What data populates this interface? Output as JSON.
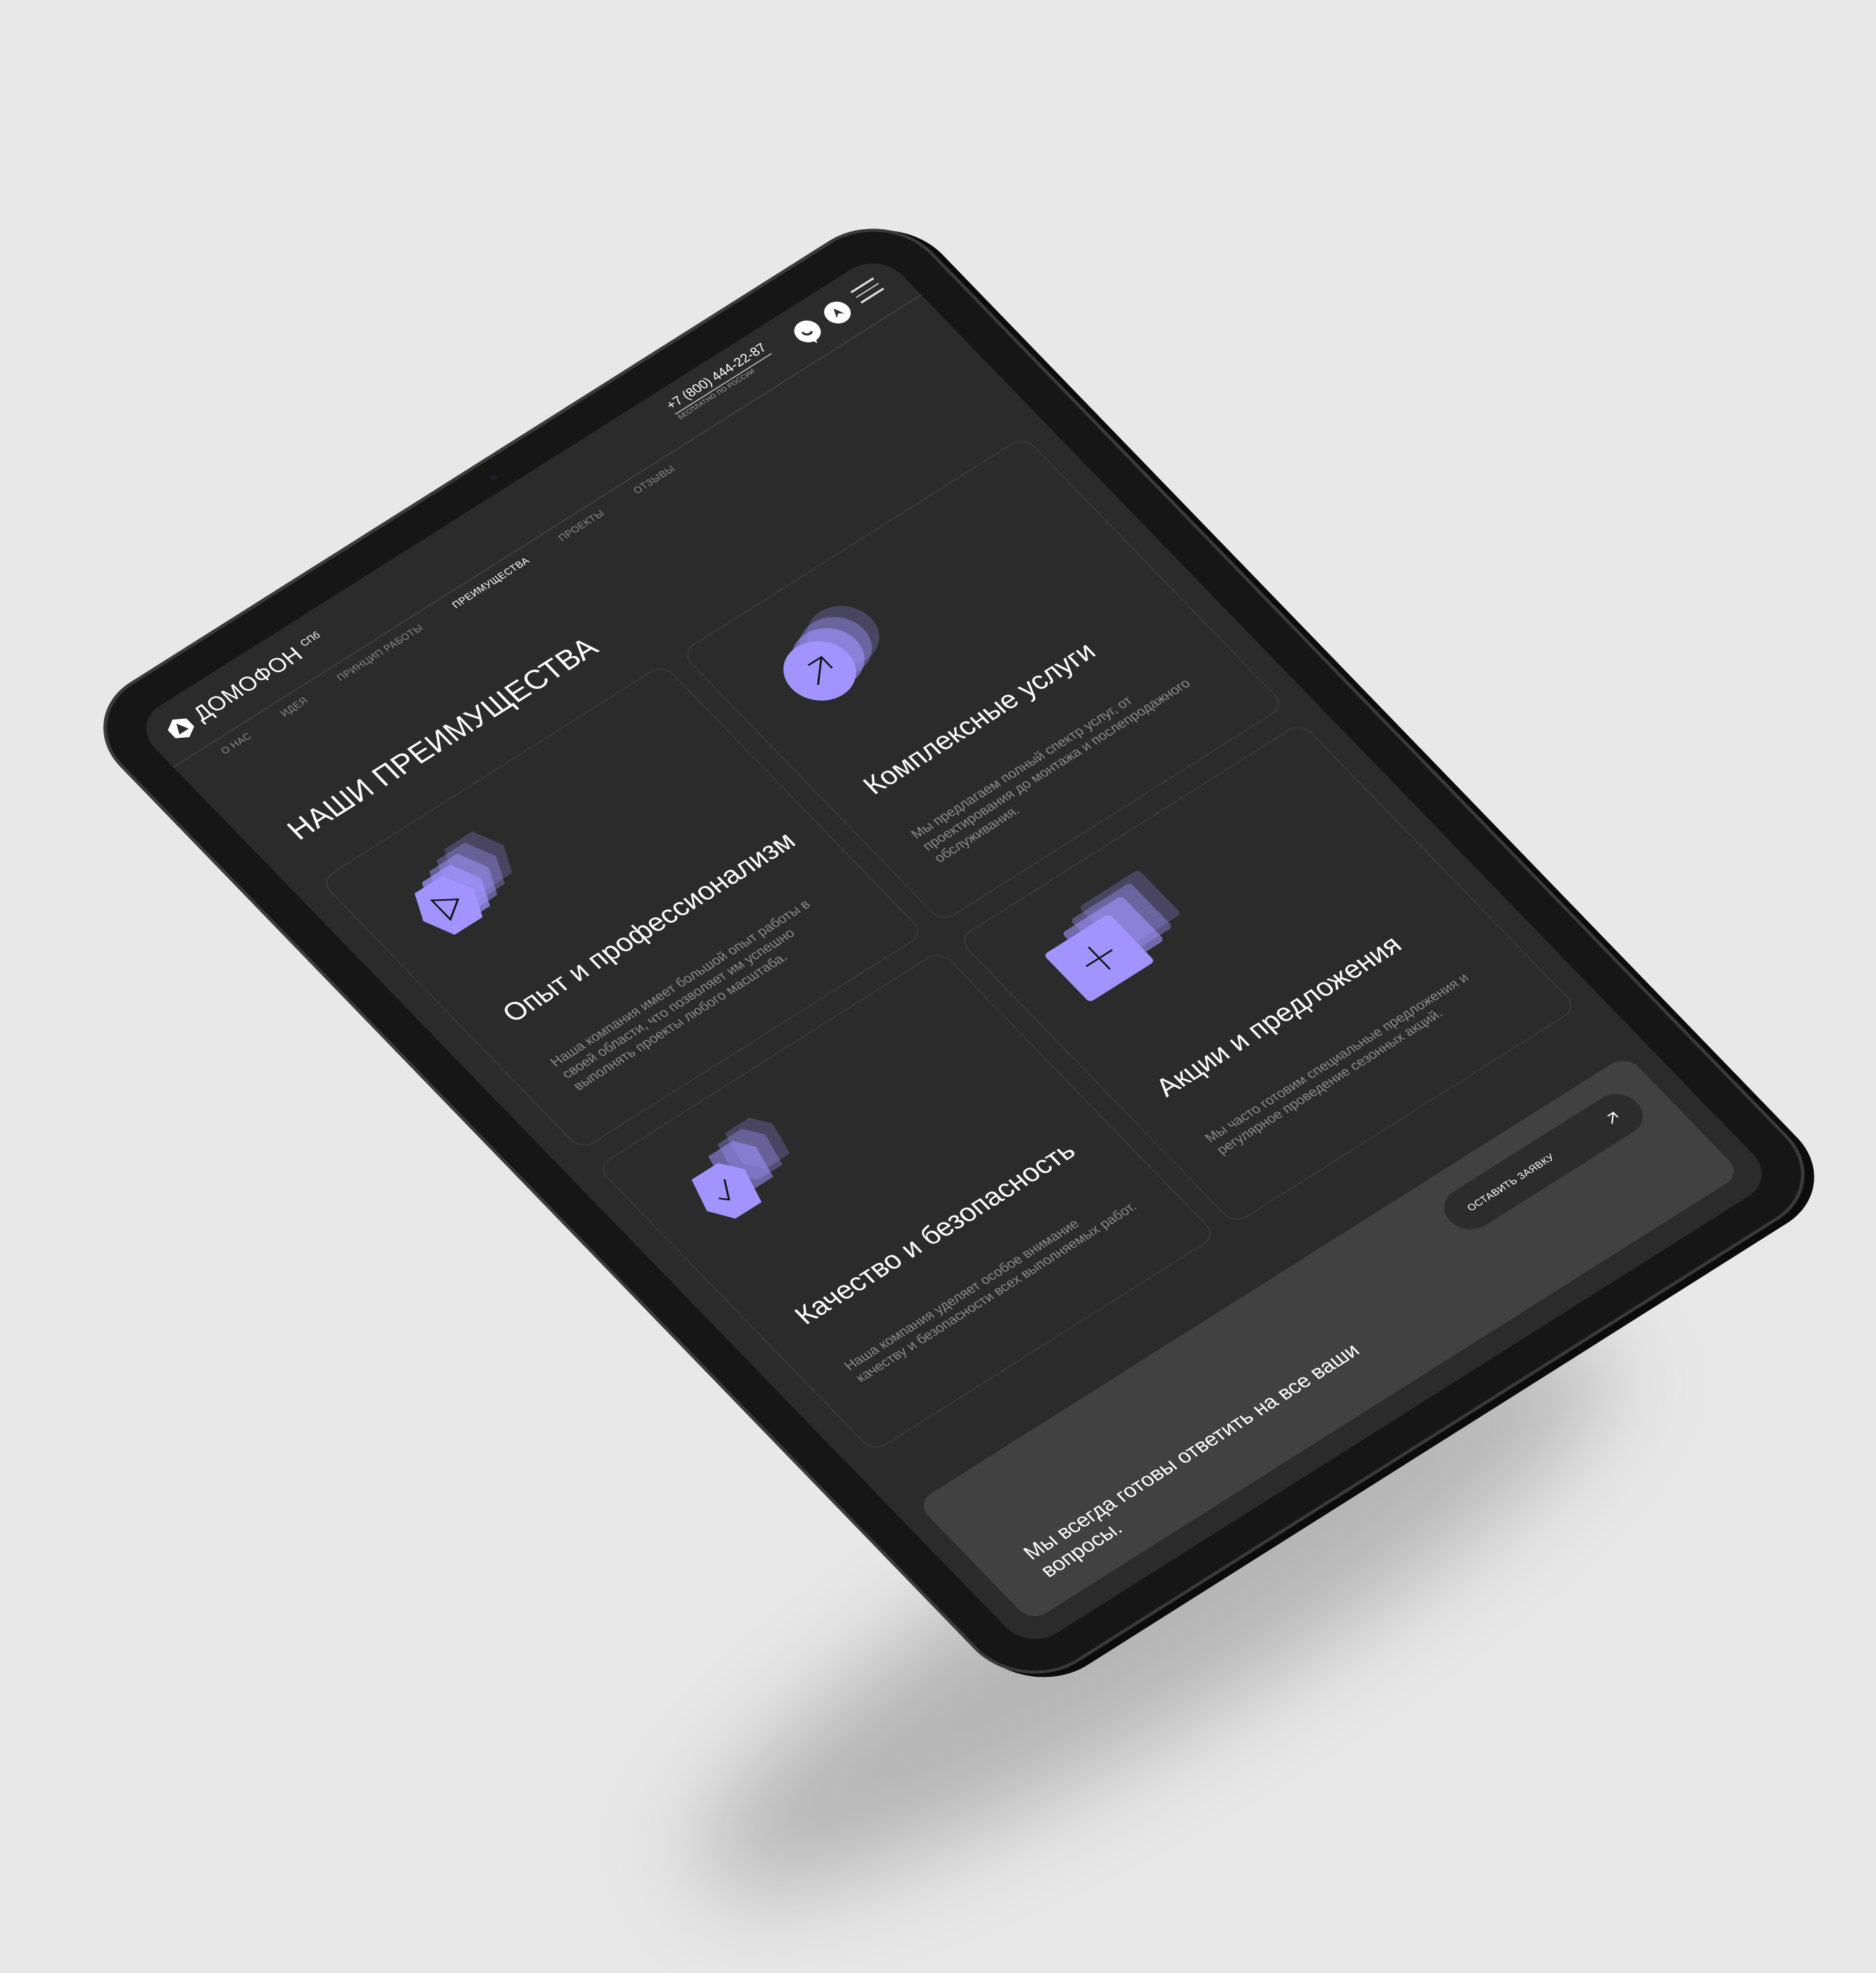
{
  "colors": {
    "accent": "#a393ff",
    "screen_bg": "#2b2b2b",
    "band_bg": "#414141",
    "page_bg": "#e8e8e8"
  },
  "header": {
    "logo": {
      "word": "ДОМОФОН",
      "sup": "СПб",
      "icon": "logo-hexagon-icon"
    },
    "phone": {
      "number": "+7 (800) 444-22-87",
      "note": "БЕСПЛАТНО ПО РОССИИ"
    },
    "icons": [
      "chat-phone-icon",
      "telegram-icon",
      "hamburger-menu-icon"
    ]
  },
  "nav": {
    "items": [
      {
        "label": "О НАС",
        "active": false
      },
      {
        "label": "ИДЕЯ",
        "active": false
      },
      {
        "label": "ПРИНЦИП РАБОТЫ",
        "active": false
      },
      {
        "label": "ПРЕИМУЩЕСТВА",
        "active": true
      },
      {
        "label": "ПРОЕКТЫ",
        "active": false
      },
      {
        "label": "ОТЗЫВЫ",
        "active": false
      }
    ]
  },
  "main": {
    "title": "НАШИ ПРЕИМУЩЕСТВА",
    "cards": [
      {
        "title": "Опыт и профессионализм",
        "text": "Наша компания имеет большой опыт работы в своей области, что позволяет им успешно выполнять проекты любого масштаба.",
        "icon": "play-icon"
      },
      {
        "title": "Комплексные услуги",
        "text": "Мы предлагаем полный спектр услуг, от проектирования до монтажа и послепродажного обслуживания.",
        "icon": "arrow-up-right-icon"
      },
      {
        "title": "Качество и безопасность",
        "text": "Наша компания уделяет особое внимание качеству и безопасности всех выполняемых работ.",
        "icon": "check-icon"
      },
      {
        "title": "Акции и предложения",
        "text": "Мы часто готовим специальные предложения и регулярное проведение сезонных акций.",
        "icon": "plus-icon"
      }
    ]
  },
  "cta_band": {
    "text": "Мы всегда готовы ответить на все ваши вопросы.",
    "button": "ОСТАВИТЬ ЗАЯВКУ",
    "button_icon": "arrow-up-right-icon"
  }
}
